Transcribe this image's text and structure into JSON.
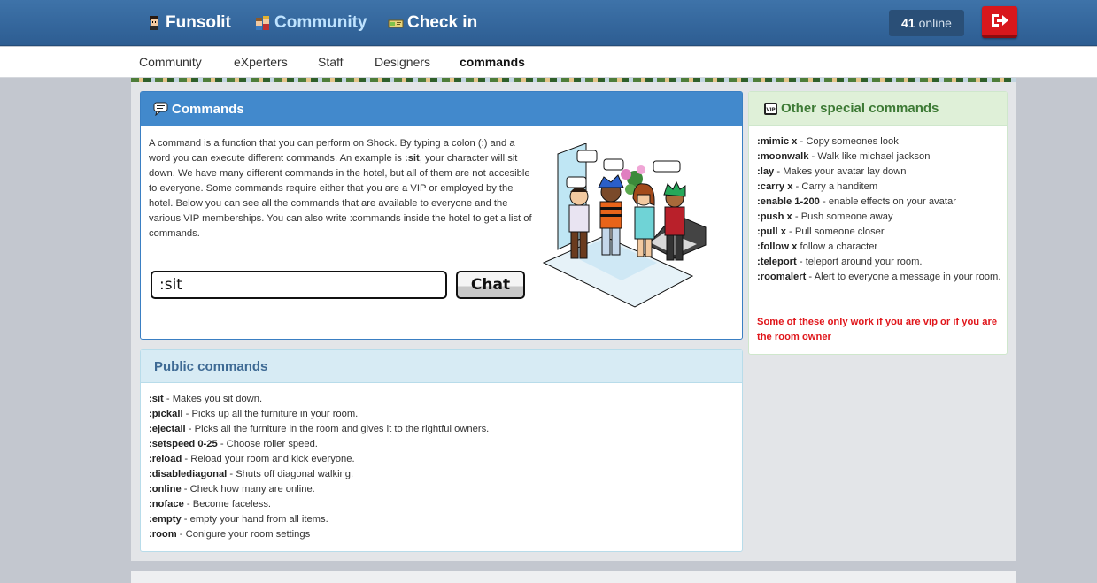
{
  "nav": {
    "items": [
      {
        "label": "Funsolit",
        "icon": "avatar-icon"
      },
      {
        "label": "Community",
        "icon": "community-icon"
      },
      {
        "label": "Check in",
        "icon": "checkin-icon"
      }
    ],
    "online_count": "41",
    "online_label": "online",
    "logout_icon": "logout-icon"
  },
  "subnav": {
    "items": [
      "Community",
      "eXperters",
      "Staff",
      "Designers",
      "commands"
    ],
    "active": "commands"
  },
  "commands_panel": {
    "title": "Commands",
    "intro_before": "A command is a function that you can perform on Shock. By typing a colon (:) and a word you can execute different commands. An example is ",
    "intro_bold": ":sit",
    "intro_after": ", your character will sit down. We have many different commands in the hotel, but all of them are not accesible to everyone. Some commands require either that you are a VIP or employed by the hotel. Below you can see all the commands that are available to everyone and the various VIP memberships. You can also write :commands inside the hotel to get a list of commands.",
    "chat_value": ":sit",
    "chat_button": "Chat"
  },
  "public_panel": {
    "title": "Public commands",
    "items": [
      {
        "cmd": ":sit",
        "desc": " - Makes you sit down."
      },
      {
        "cmd": ":pickall",
        "desc": " - Picks up all the furniture in your room."
      },
      {
        "cmd": ":ejectall",
        "desc": " - Picks all the furniture in the room and gives it to the rightful owners."
      },
      {
        "cmd": ":setspeed 0-25",
        "desc": " - Choose roller speed."
      },
      {
        "cmd": ":reload",
        "desc": " - Reload your room and kick everyone."
      },
      {
        "cmd": ":disablediagonal",
        "desc": " - Shuts off diagonal walking."
      },
      {
        "cmd": ":online",
        "desc": " - Check how many are online."
      },
      {
        "cmd": ":noface",
        "desc": " - Become faceless."
      },
      {
        "cmd": ":empty",
        "desc": " - empty your hand from all items."
      },
      {
        "cmd": ":room",
        "desc": " - Conigure your room settings"
      }
    ]
  },
  "other_panel": {
    "title": "Other special commands",
    "items": [
      {
        "cmd": ":mimic x",
        "desc": " - Copy someones look"
      },
      {
        "cmd": ":moonwalk",
        "desc": " - Walk like michael jackson"
      },
      {
        "cmd": ":lay",
        "desc": " - Makes your avatar lay down"
      },
      {
        "cmd": ":carry x",
        "desc": " - Carry a handitem"
      },
      {
        "cmd": ":enable 1-200",
        "desc": " - enable effects on your avatar"
      },
      {
        "cmd": ":push x",
        "desc": " - Push someone away"
      },
      {
        "cmd": ":pull x",
        "desc": " - Pull someone closer"
      },
      {
        "cmd": ":follow x",
        "desc": " follow a character"
      },
      {
        "cmd": ":teleport",
        "desc": " - teleport around your room."
      },
      {
        "cmd": ":roomalert",
        "desc": " - Alert to everyone a message in your room."
      }
    ],
    "warning": "Some of these only work if you are vip or if you are the room owner"
  },
  "colors": {
    "topbar": "#3566a0",
    "commands_header": "#4289cc",
    "public_header": "#d7ebf4",
    "other_header": "#dff0d8",
    "warning": "#e0161b"
  }
}
